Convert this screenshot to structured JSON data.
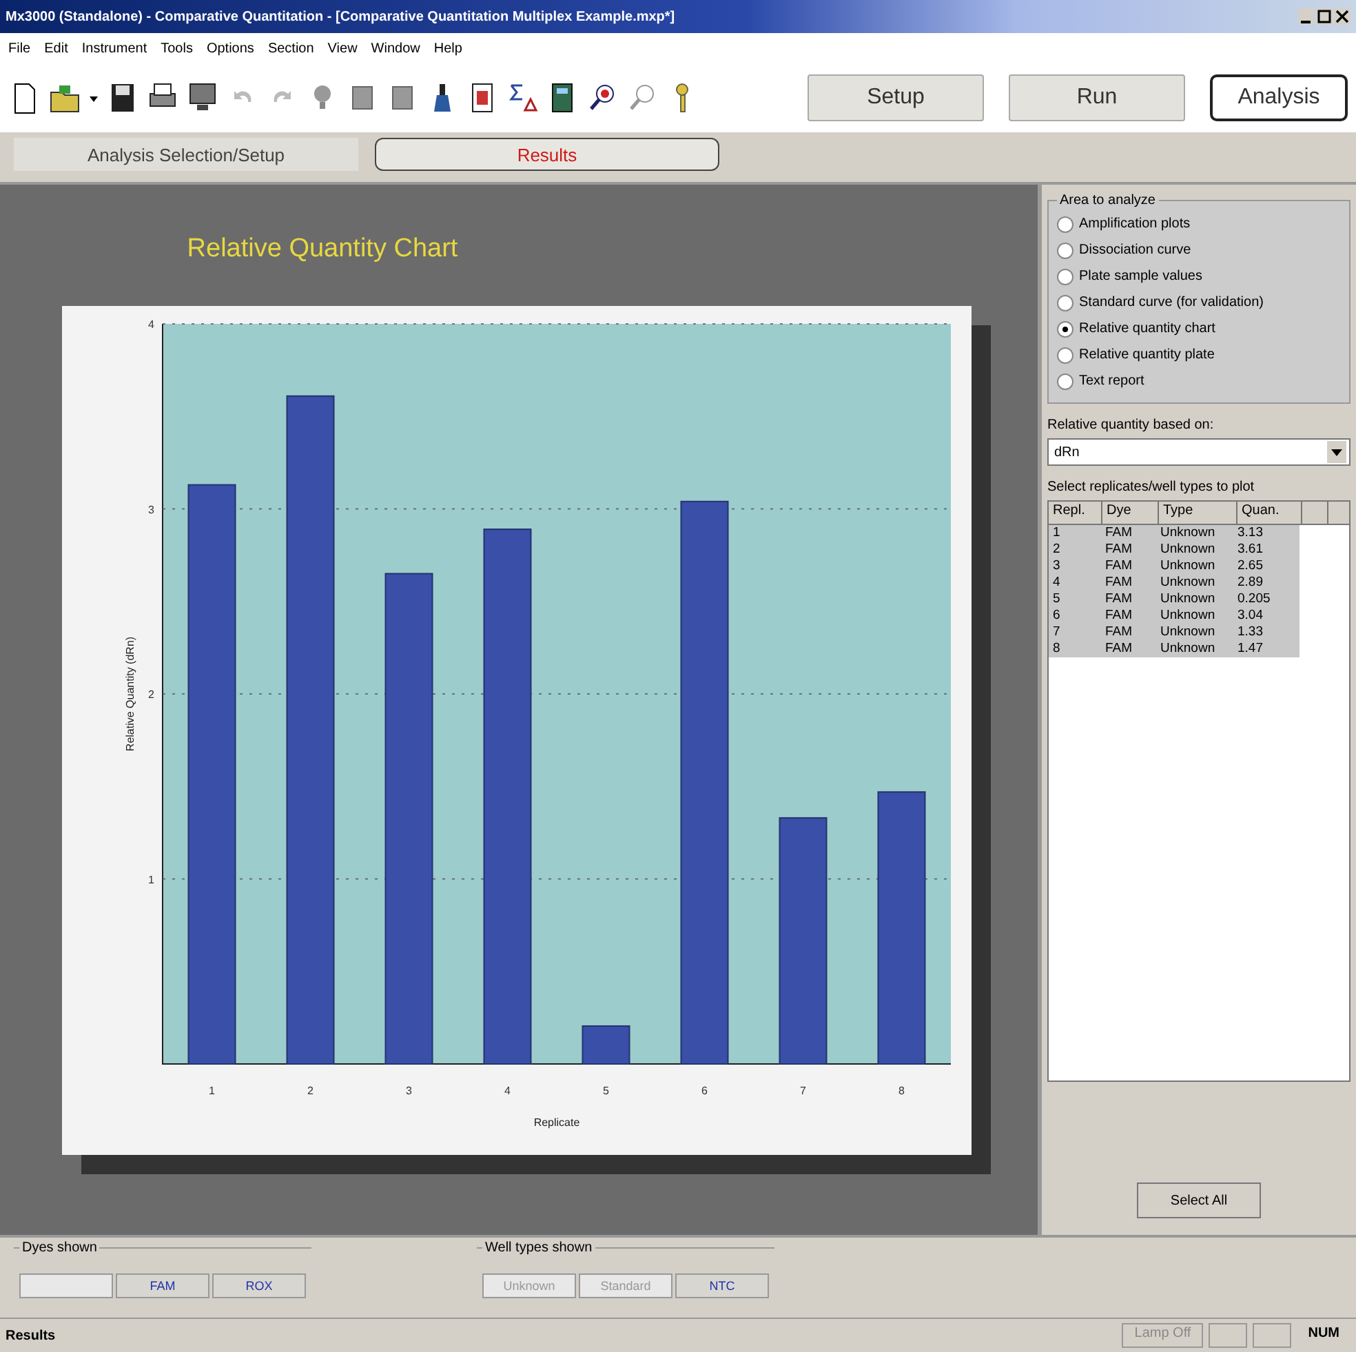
{
  "window": {
    "title": "Mx3000 (Standalone) - Comparative Quantitation - [Comparative Quantitation Multiplex Example.mxp*]"
  },
  "menu": [
    "File",
    "Edit",
    "Instrument",
    "Tools",
    "Options",
    "Section",
    "View",
    "Window",
    "Help"
  ],
  "mode_buttons": [
    {
      "label": "Setup",
      "selected": false
    },
    {
      "label": "Run",
      "selected": false
    },
    {
      "label": "Analysis",
      "selected": true
    }
  ],
  "section_tabs": [
    {
      "label": "Analysis Selection/Setup",
      "selected": false
    },
    {
      "label": "Results",
      "selected": true
    }
  ],
  "chart": {
    "title": "Relative Quantity Chart",
    "chart_data": {
      "type": "bar",
      "xlabel": "Replicate",
      "ylabel": "Relative Quantity (dRn)",
      "categories": [
        "1",
        "2",
        "3",
        "4",
        "5",
        "6",
        "7",
        "8"
      ],
      "values": [
        3.13,
        3.61,
        2.65,
        2.89,
        0.205,
        3.04,
        1.33,
        1.47
      ],
      "ylim": [
        0,
        4
      ],
      "yticks": [
        1,
        2,
        3,
        4
      ],
      "grid": true
    }
  },
  "area_to_analyze": {
    "label": "Area to analyze",
    "options": [
      {
        "label": "Amplification plots",
        "selected": false
      },
      {
        "label": "Dissociation curve",
        "selected": false
      },
      {
        "label": "Plate sample values",
        "selected": false
      },
      {
        "label": "Standard curve (for validation)",
        "selected": false
      },
      {
        "label": "Relative quantity chart",
        "selected": true
      },
      {
        "label": "Relative quantity plate",
        "selected": false
      },
      {
        "label": "Text report",
        "selected": false
      }
    ]
  },
  "based_on": {
    "label": "Relative quantity based on:",
    "value": "dRn"
  },
  "replicates": {
    "label": "Select replicates/well types to plot",
    "columns": [
      "Repl.",
      "Dye",
      "Type",
      "Quan."
    ],
    "rows": [
      {
        "cells": [
          "1",
          "FAM",
          "Unknown",
          "3.13"
        ],
        "selected": true
      },
      {
        "cells": [
          "2",
          "FAM",
          "Unknown",
          "3.61"
        ],
        "selected": true
      },
      {
        "cells": [
          "3",
          "FAM",
          "Unknown",
          "2.65"
        ],
        "selected": true
      },
      {
        "cells": [
          "4",
          "FAM",
          "Unknown",
          "2.89"
        ],
        "selected": true
      },
      {
        "cells": [
          "5",
          "FAM",
          "Unknown",
          "0.205"
        ],
        "selected": true
      },
      {
        "cells": [
          "6",
          "FAM",
          "Unknown",
          "3.04"
        ],
        "selected": true
      },
      {
        "cells": [
          "7",
          "FAM",
          "Unknown",
          "1.33"
        ],
        "selected": true
      },
      {
        "cells": [
          "8",
          "FAM",
          "Unknown",
          "1.47"
        ],
        "selected": true
      }
    ]
  },
  "select_all": "Select All",
  "dyes_shown": {
    "label": "Dyes shown",
    "buttons": [
      {
        "disabled": true
      },
      {
        "label": "FAM",
        "disabled": false
      },
      {
        "label": "ROX",
        "disabled": false
      }
    ]
  },
  "well_types_shown": {
    "label": "Well types shown",
    "buttons": [
      {
        "label": "Unknown",
        "disabled": true
      },
      {
        "label": "Standard",
        "disabled": true
      },
      {
        "label": "NTC",
        "disabled": false
      }
    ]
  },
  "status_bar": {
    "text": "Results",
    "panes": [
      "Lamp Off",
      "NUM"
    ]
  }
}
